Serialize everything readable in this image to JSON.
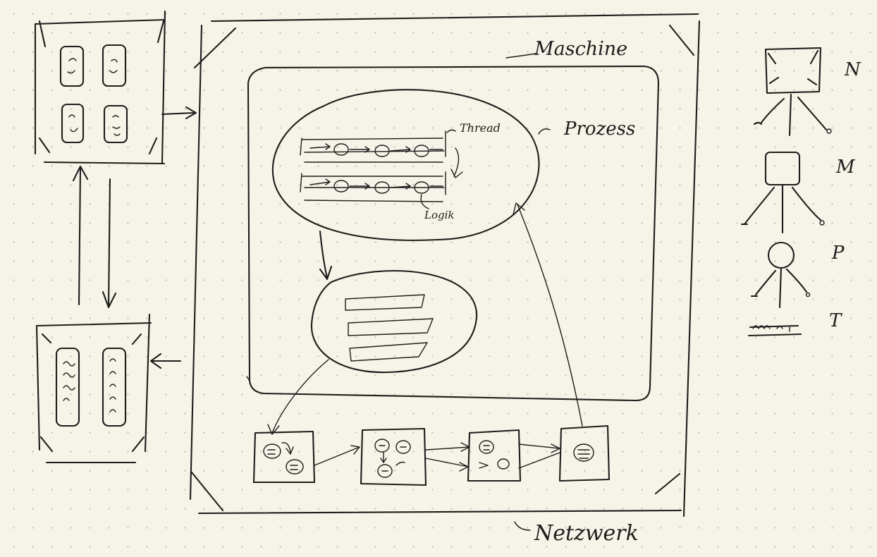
{
  "labels": {
    "machine": "Maschine",
    "thread": "Thread",
    "process": "Prozess",
    "logic": "Logik",
    "network": "Netzwerk"
  },
  "legend": {
    "n": "N",
    "m": "M",
    "p": "P",
    "t": "T"
  }
}
